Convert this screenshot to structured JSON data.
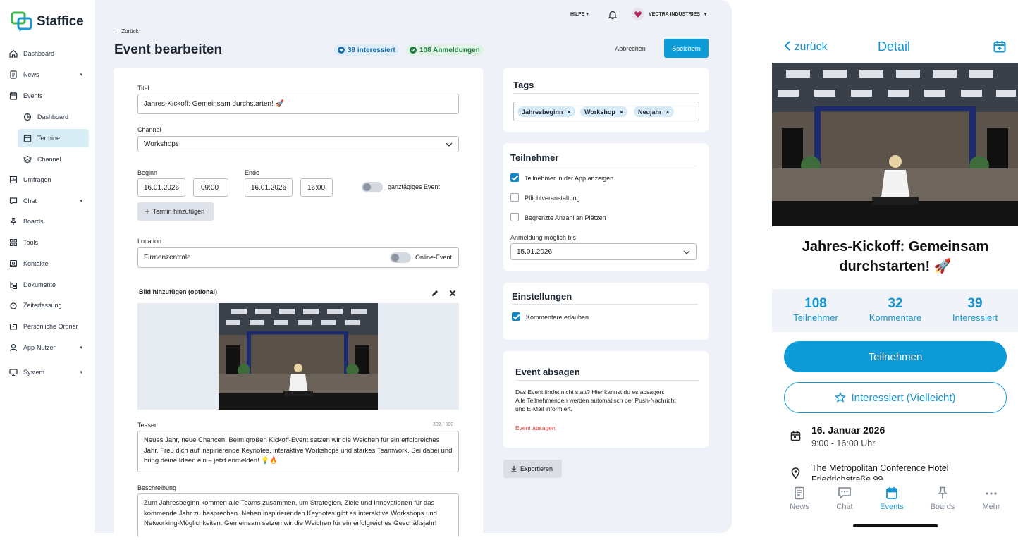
{
  "app": {
    "brand": "Staffice"
  },
  "sidebar": {
    "items": [
      {
        "label": "Dashboard",
        "icon": "home-icon"
      },
      {
        "label": "News",
        "icon": "news-icon",
        "chevron": "▾"
      },
      {
        "label": "Events",
        "icon": "calendar-icon"
      },
      {
        "label": "Dashboard",
        "icon": "pie-chart-icon"
      },
      {
        "label": "Termine",
        "icon": "calendar-icon"
      },
      {
        "label": "Channel",
        "icon": "layers-icon"
      },
      {
        "label": "Umfragen",
        "icon": "bar-chart-icon"
      },
      {
        "label": "Chat",
        "icon": "chat-icon",
        "chevron": "▾"
      },
      {
        "label": "Boards",
        "icon": "pin-icon"
      },
      {
        "label": "Tools",
        "icon": "grid-icon"
      },
      {
        "label": "Kontakte",
        "icon": "contact-icon"
      },
      {
        "label": "Dokumente",
        "icon": "folder-tree-icon"
      },
      {
        "label": "Zeiterfassung",
        "icon": "stopwatch-icon"
      },
      {
        "label": "Persönliche Ordner",
        "icon": "folder-user-icon"
      },
      {
        "label": "App-Nutzer",
        "icon": "user-icon",
        "chevron": "▾"
      },
      {
        "label": "System",
        "icon": "monitor-icon",
        "chevron": "▾"
      }
    ]
  },
  "topbar": {
    "help": "HILFE",
    "org": "VECTRA INDUSTRIES",
    "caret": "▾"
  },
  "header": {
    "back": "Zurück",
    "title": "Event bearbeiten",
    "interested": "39 interessiert",
    "registrations": "108 Anmeldungen",
    "cancel": "Abbrechen",
    "save": "Speichern"
  },
  "form": {
    "title_label": "Titel",
    "title_value": "Jahres-Kickoff: Gemeinsam durchstarten! 🚀",
    "channel_label": "Channel",
    "channel_value": "Workshops",
    "start_label": "Beginn",
    "start_date": "16.01.2026",
    "start_time": "09:00",
    "end_label": "Ende",
    "end_date": "16.01.2026",
    "end_time": "16:00",
    "allday_label": "ganztägiges Event",
    "allday_on": false,
    "add_date": "Termin hinzufügen",
    "location_label": "Location",
    "location_value": "Firmenzentrale",
    "online_label": "Online-Event",
    "online_on": false,
    "image_label": "Bild hinzufügen (optional)",
    "teaser_label": "Teaser",
    "teaser_count": "302 / 500",
    "teaser_value": "Neues Jahr, neue Chancen! Beim großen Kickoff-Event setzen wir die Weichen für ein erfolgreiches Jahr. Freu dich auf inspirierende Keynotes, interaktive Workshops und starkes Teamwork. Sei dabei und bring deine Ideen ein – jetzt anmelden! 💡🔥",
    "desc_label": "Beschreibung",
    "desc_value": "Zum Jahresbeginn kommen alle Teams zusammen, um Strategien, Ziele und Innovationen für das kommende Jahr zu besprechen. Neben inspirierenden Keynotes gibt es interaktive Workshops und Networking-Möglichkeiten. Gemeinsam setzen wir die Weichen für ein erfolgreiches Geschäftsjahr!"
  },
  "tags": {
    "title": "Tags",
    "items": [
      "Jahresbeginn",
      "Workshop",
      "Neujahr"
    ],
    "remove": "×"
  },
  "participants": {
    "title": "Teilnehmer",
    "show_in_app": "Teilnehmer in der App anzeigen",
    "show_in_app_checked": true,
    "mandatory": "Pflichtveranstaltung",
    "mandatory_checked": false,
    "limited": "Begrenzte Anzahl an Plätzen",
    "limited_checked": false,
    "deadline_label": "Anmeldung möglich bis",
    "deadline_value": "15.01.2026"
  },
  "settings": {
    "title": "Einstellungen",
    "comments": "Kommentare erlauben",
    "comments_checked": true
  },
  "cancel_event": {
    "title": "Event absagen",
    "text1": "Das Event findet nicht statt? Hier kannst du es absagen.",
    "text2": "Alle Teilnehmenden werden automatisch per Push-Nachricht",
    "text3": "und E-Mail informiert.",
    "link": "Event absagen"
  },
  "export": "Exportieren",
  "mobile": {
    "back": "zurück",
    "title": "Detail",
    "event_title_line1": "Jahres-Kickoff: Gemeinsam",
    "event_title_line2": "durchstarten! 🚀",
    "stats": [
      {
        "n": "108",
        "l": "Teilnehmer"
      },
      {
        "n": "32",
        "l": "Kommentare"
      },
      {
        "n": "39",
        "l": "Interessiert"
      }
    ],
    "participate": "Teilnehmen",
    "interested": "Interessiert (Vielleicht)",
    "date": "16. Januar 2026",
    "time": "9:00 - 16:00 Uhr",
    "venue": "The Metropolitan Conference Hotel",
    "street": "Friedrichstraße 99",
    "tabs": [
      "News",
      "Chat",
      "Events",
      "Boards",
      "Mehr"
    ],
    "active_tab": "Events"
  },
  "colors": {
    "accent": "#0d9bd8",
    "danger": "#e53935",
    "sidebar_active": "#d9edf7",
    "main_bg": "#eef1f8"
  }
}
